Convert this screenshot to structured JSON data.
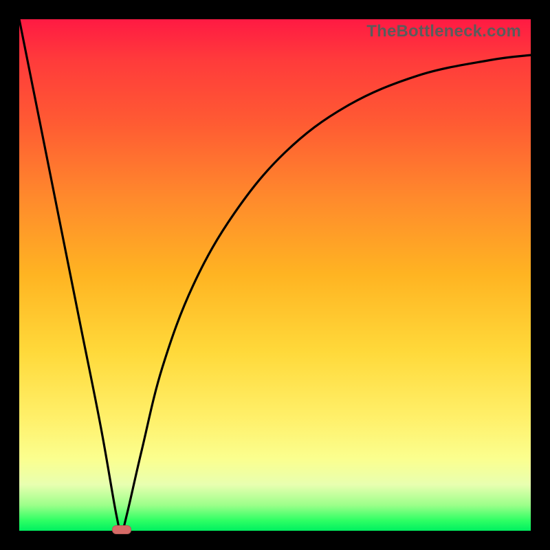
{
  "attribution": "TheBottleneck.com",
  "colors": {
    "background": "#000000",
    "gradient_top": "#ff1a43",
    "gradient_mid": "#ffd93a",
    "gradient_bottom": "#00f060",
    "curve": "#000000",
    "marker": "#d66a66"
  },
  "chart_data": {
    "type": "line",
    "title": "",
    "xlabel": "",
    "ylabel": "",
    "xlim": [
      0,
      100
    ],
    "ylim": [
      0,
      100
    ],
    "note": "Axes have no tick labels; values inferred as percent of plot width/height. Curve is a V reaching 0 near x≈20 then rising with diminishing slope.",
    "series": [
      {
        "name": "curve",
        "x": [
          0,
          4,
          8,
          12,
          16,
          19,
          20,
          21,
          24,
          28,
          34,
          42,
          52,
          64,
          78,
          92,
          100
        ],
        "y": [
          100,
          80,
          60,
          40,
          20,
          3,
          0,
          3,
          16,
          32,
          48,
          62,
          74,
          83,
          89,
          92,
          93
        ]
      }
    ],
    "marker": {
      "x": 20,
      "y": 0,
      "shape": "pill"
    }
  }
}
